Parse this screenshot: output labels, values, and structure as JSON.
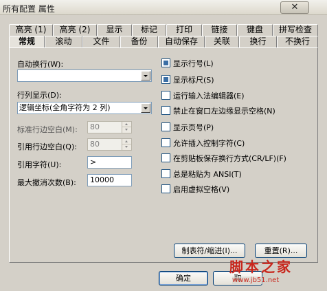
{
  "window": {
    "title": "所有配置 属性",
    "close_glyph": "✕"
  },
  "tabs_top": [
    "高亮 (1)",
    "高亮 (2)",
    "显示",
    "标记",
    "打印",
    "链接",
    "键盘",
    "拼写检查"
  ],
  "tabs_bottom": [
    "常规",
    "滚动",
    "文件",
    "备份",
    "自动保存",
    "关联",
    "换行",
    "不换行"
  ],
  "active_tab": "常规",
  "form": {
    "auto_wrap_label": "自动换行(W):",
    "auto_wrap_value": "",
    "column_display_label": "行列显示(D):",
    "column_display_value": "逻辑坐标(全角字符为 2 列)",
    "std_indent_label": "标准行边空白(M):",
    "std_indent_value": "80",
    "quote_indent_label": "引用行边空白(Q):",
    "quote_indent_value": "80",
    "quote_char_label": "引用字符(U):",
    "quote_char_value": ">",
    "max_undo_label": "最大撤消次数(B):",
    "max_undo_value": "10000"
  },
  "checkboxes": [
    {
      "label": "显示行号(L)",
      "checked": true
    },
    {
      "label": "显示标尺(S)",
      "checked": true
    },
    {
      "label": "运行输入法编辑器(E)",
      "checked": false
    },
    {
      "label": "禁止在窗口左边缘显示空格(N)",
      "checked": false
    },
    {
      "label": "显示页号(P)",
      "checked": false
    },
    {
      "label": "允许插入控制字符(C)",
      "checked": false
    },
    {
      "label": "在剪贴板保存换行方式(CR/LF)(F)",
      "checked": false
    },
    {
      "label": "总是粘贴为 ANSI(T)",
      "checked": false
    },
    {
      "label": "启用虚拟空格(V)",
      "checked": false
    }
  ],
  "buttons": {
    "tab_indent": "制表符/缩进(I)...",
    "reset": "重置(R)...",
    "ok": "确定",
    "cancel": "取"
  },
  "watermark": {
    "main": "脚本之家",
    "url": "www.jb51.net"
  }
}
